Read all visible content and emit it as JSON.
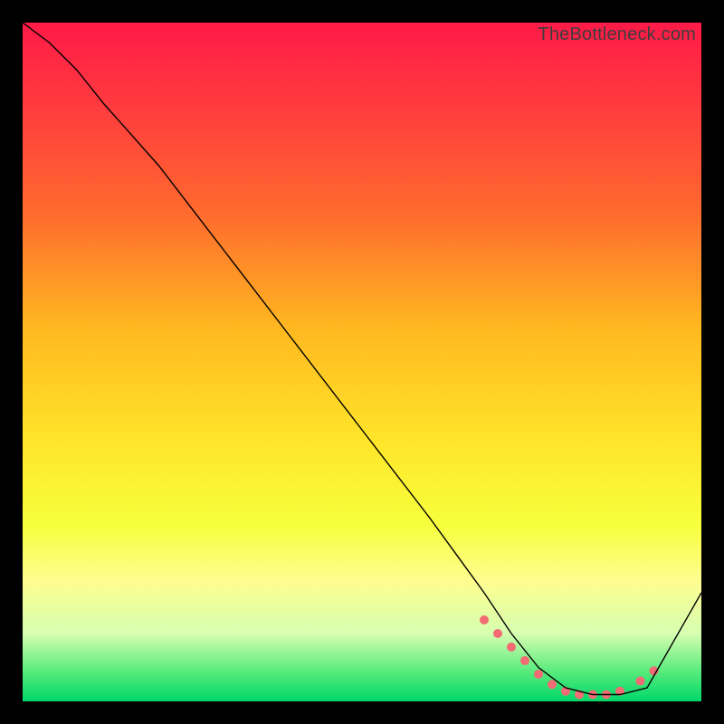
{
  "watermark": "TheBottleneck.com",
  "chart_data": {
    "type": "line",
    "title": "",
    "xlabel": "",
    "ylabel": "",
    "xlim": [
      0,
      100
    ],
    "ylim": [
      0,
      100
    ],
    "grid": false,
    "legend": false,
    "background": {
      "type": "vertical-gradient",
      "stops": [
        {
          "pos": 0,
          "color": "#ff1a47"
        },
        {
          "pos": 12,
          "color": "#ff3a3f"
        },
        {
          "pos": 28,
          "color": "#ff6a2e"
        },
        {
          "pos": 45,
          "color": "#ffb820"
        },
        {
          "pos": 62,
          "color": "#ffe62a"
        },
        {
          "pos": 74,
          "color": "#f7ff3c"
        },
        {
          "pos": 82,
          "color": "#fffd8e"
        },
        {
          "pos": 90,
          "color": "#d6ffb0"
        },
        {
          "pos": 96,
          "color": "#4fe97a"
        },
        {
          "pos": 100,
          "color": "#00d76a"
        }
      ]
    },
    "series": [
      {
        "name": "curve",
        "color": "#000000",
        "stroke_width": 1.4,
        "x": [
          0,
          4,
          8,
          12,
          20,
          30,
          40,
          50,
          60,
          68,
          72,
          76,
          80,
          84,
          88,
          92,
          100
        ],
        "y": [
          100,
          97,
          93,
          88,
          79,
          66,
          53,
          40,
          27,
          16,
          10,
          5,
          2,
          1,
          1,
          2,
          16
        ]
      }
    ],
    "markers": {
      "name": "dotted-bottom",
      "color": "#f36b74",
      "radius": 5,
      "points": [
        {
          "x": 68,
          "y": 12
        },
        {
          "x": 70,
          "y": 10
        },
        {
          "x": 72,
          "y": 8
        },
        {
          "x": 74,
          "y": 6
        },
        {
          "x": 76,
          "y": 4
        },
        {
          "x": 78,
          "y": 2.5
        },
        {
          "x": 80,
          "y": 1.5
        },
        {
          "x": 82,
          "y": 1
        },
        {
          "x": 84,
          "y": 1
        },
        {
          "x": 86,
          "y": 1
        },
        {
          "x": 88,
          "y": 1.5
        },
        {
          "x": 91,
          "y": 3
        },
        {
          "x": 93,
          "y": 4.5
        }
      ]
    }
  }
}
